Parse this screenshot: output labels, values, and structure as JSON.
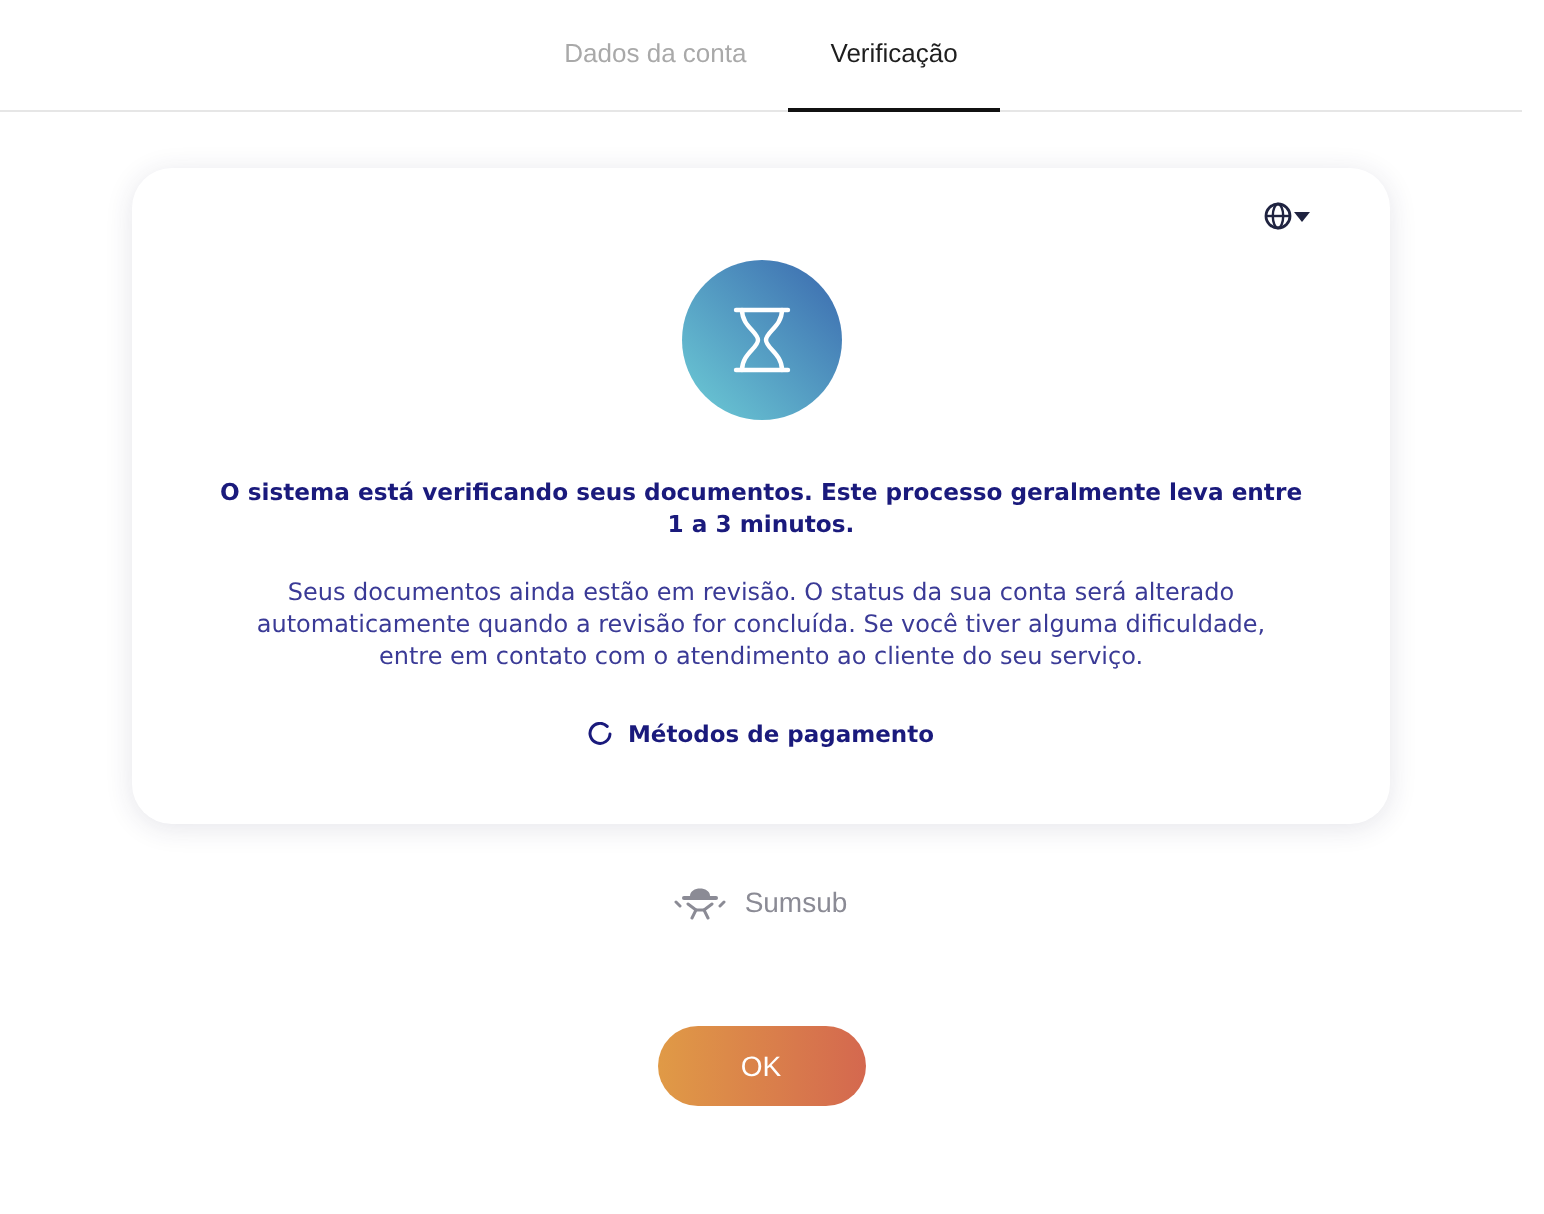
{
  "tabs": [
    {
      "label": "Dados da conta",
      "selected": false
    },
    {
      "label": "Verificação",
      "selected": true
    }
  ],
  "card": {
    "title": "O sistema está verificando seus documentos. Este processo geralmente leva entre 1 a 3 minutos.",
    "description": "Seus documentos ainda estão em revisão. O status da sua conta será alterado automaticamente quando a revisão for concluída. Se você tiver alguma dificuldade, entre em contato com o atendimento ao cliente do seu serviço.",
    "status_item": {
      "label": "Métodos de pagamento"
    }
  },
  "provider": {
    "label": "Sumsub"
  },
  "buttons": [
    {
      "label": "OK"
    }
  ]
}
